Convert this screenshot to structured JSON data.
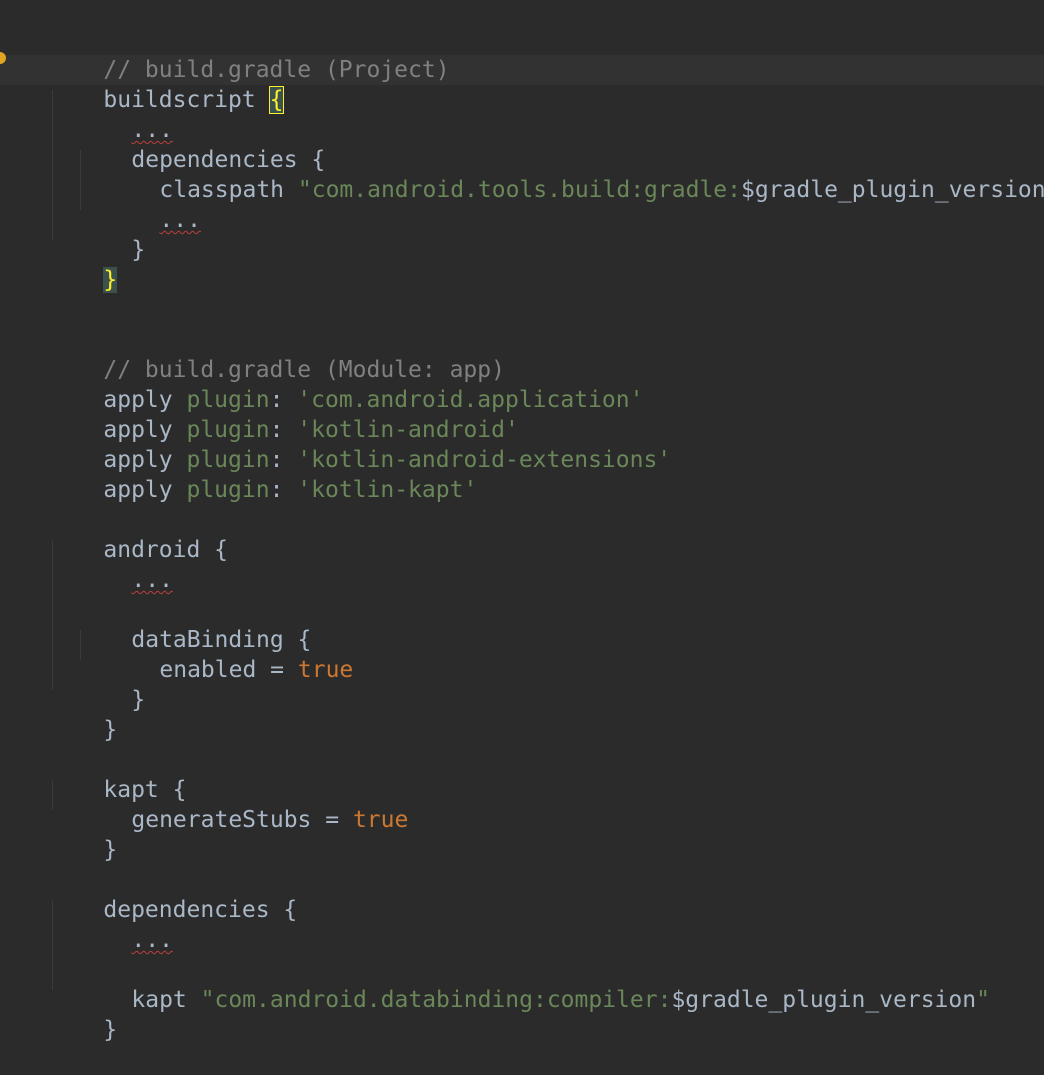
{
  "editor": {
    "lines": [
      {
        "text": "// build.gradle (Project)",
        "kind": "comment"
      },
      {
        "text": "buildscript ",
        "brace": "{"
      },
      {
        "text": "..."
      },
      {
        "text": "dependencies {"
      },
      {
        "prefix": "classpath ",
        "string": "\"com.android.tools.build:gradle:",
        "var": "$gradle_plugin_version",
        "suffix": "\""
      },
      {
        "text": "..."
      },
      {
        "text": "}"
      },
      {
        "text": "}"
      },
      {
        "text": "// build.gradle (Module: app)",
        "kind": "comment"
      },
      {
        "keyword": "apply ",
        "plugin": "plugin",
        "colon": ": ",
        "string": "'com.android.application'"
      },
      {
        "keyword": "apply ",
        "plugin": "plugin",
        "colon": ": ",
        "string": "'kotlin-android'"
      },
      {
        "keyword": "apply ",
        "plugin": "plugin",
        "colon": ": ",
        "string": "'kotlin-android-extensions'"
      },
      {
        "keyword": "apply ",
        "plugin": "plugin",
        "colon": ": ",
        "string": "'kotlin-kapt'"
      },
      {
        "text": "android {"
      },
      {
        "text": "..."
      },
      {
        "text": "dataBinding {"
      },
      {
        "prefix": "enabled = ",
        "bool": "true"
      },
      {
        "text": "}"
      },
      {
        "text": "}"
      },
      {
        "text": "kapt {"
      },
      {
        "prefix": "generateStubs = ",
        "bool": "true"
      },
      {
        "text": "}"
      },
      {
        "text": "dependencies {"
      },
      {
        "text": "..."
      },
      {
        "prefix": "kapt ",
        "string": "\"com.android.databinding:compiler:",
        "var": "$gradle_plugin_version",
        "suffix": "\""
      },
      {
        "text": "}"
      }
    ]
  },
  "colors": {
    "background": "#2b2b2b",
    "comment": "#808080",
    "string": "#6a8759",
    "keyword": "#cc7832",
    "identifier": "#9876aa",
    "text": "#a9b7c6",
    "brace_highlight": "#ffef28"
  }
}
